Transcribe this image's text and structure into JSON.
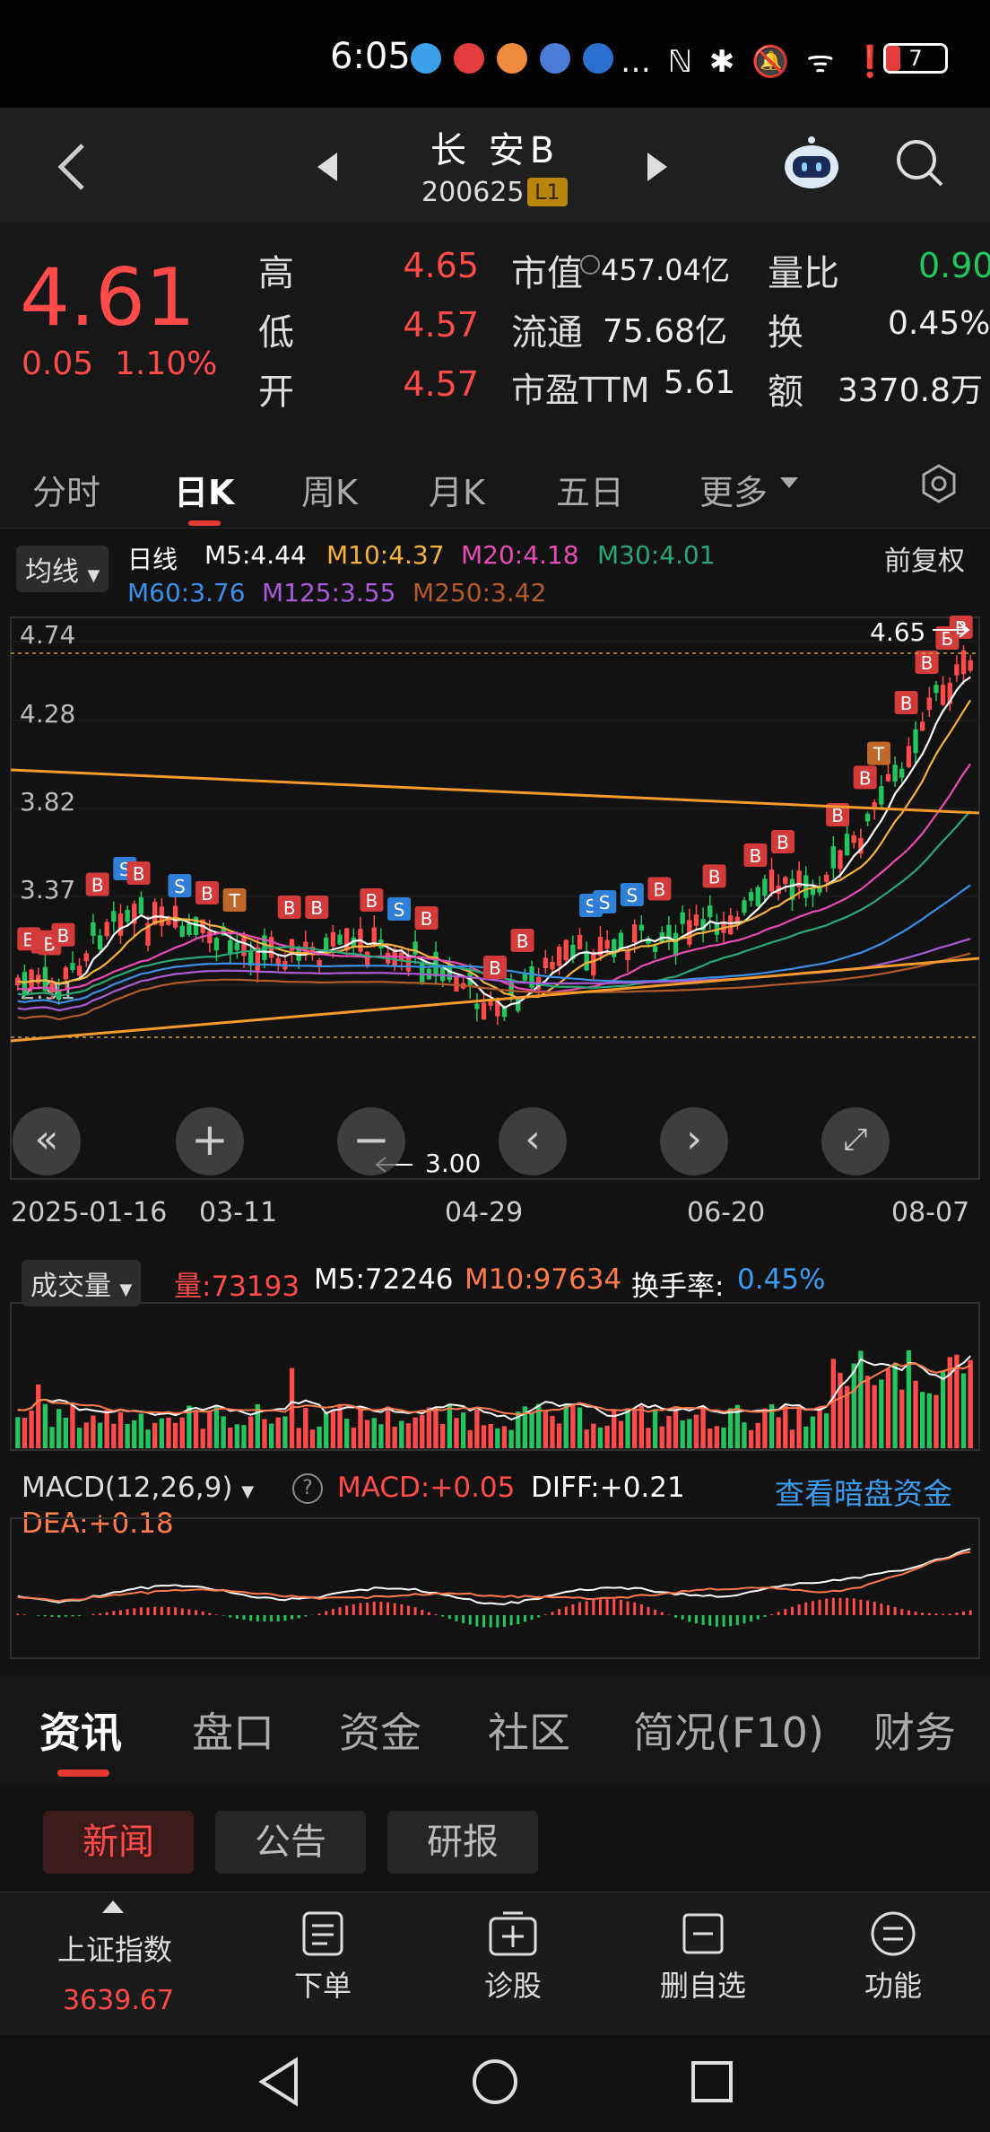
{
  "status_bar": {
    "time": "6:05",
    "right_icons": "… ℕ ✱ 🔕 ᯤ ❗",
    "battery": "7"
  },
  "header": {
    "back_icon": "chevron-left-icon",
    "stock_name": "长 安B",
    "stock_code": "200625",
    "level_badge": "L1"
  },
  "quote": {
    "price": "4.61",
    "change": "0.05",
    "change_pct": "1.10%",
    "high_label": "高",
    "high": "4.65",
    "low_label": "低",
    "low": "4.57",
    "open_label": "开",
    "open": "4.57",
    "mktcap_label": "市值",
    "mktcap": "457.04亿",
    "float_label": "流通",
    "float": "75.68亿",
    "pe_label": "市盈TTM",
    "pe": "5.61",
    "volratio_label": "量比",
    "volratio": "0.90",
    "turnover_label": "换",
    "turnover": "0.45%",
    "amount_label": "额",
    "amount": "3370.8万"
  },
  "tabs": [
    "分时",
    "日K",
    "周K",
    "月K",
    "五日",
    "更多"
  ],
  "ma_legend": {
    "selector": "均线",
    "daily": "日线",
    "m5": "M5:4.44",
    "m10": "M10:4.37",
    "m20": "M20:4.18",
    "m30": "M30:4.01",
    "m60": "M60:3.76",
    "m125": "M125:3.55",
    "m250": "M250:3.42",
    "adjust": "前复权"
  },
  "price_chart": {
    "y_labels": [
      "4.74",
      "4.28",
      "3.82",
      "3.37",
      "2.91"
    ],
    "max_label": "4.65",
    "min_label": "3.00",
    "x_labels": [
      "2025-01-16",
      "03-11",
      "04-29",
      "06-20",
      "08-07"
    ]
  },
  "volume_legend": {
    "selector": "成交量",
    "vol": "量:73193",
    "m5": "M5:72246",
    "m10": "M10:97634",
    "turnover_label": "换手率:",
    "turnover": "0.45%"
  },
  "macd_legend": {
    "selector": "MACD(12,26,9)",
    "macd": "MACD:+0.05",
    "diff": "DIFF:+0.21",
    "dea": "DEA:+0.18",
    "link": "查看暗盘资金"
  },
  "news_tabs": [
    "资讯",
    "盘口",
    "资金",
    "社区",
    "简况(F10)",
    "财务"
  ],
  "news_pills": [
    "新闻",
    "公告",
    "研报"
  ],
  "bottom_bar": {
    "index_name": "上证指数",
    "index_value": "3639.67",
    "items": [
      "下单",
      "诊股",
      "删自选",
      "功能"
    ]
  },
  "colors": {
    "up": "#ff4a4a",
    "down": "#22c55e",
    "m5": "#ffffff",
    "m10": "#f5b33a",
    "m20": "#e84bb3",
    "m30": "#2aa876",
    "m60": "#3b8fe8",
    "m125": "#a95bd6",
    "m250": "#b35a2a"
  }
}
